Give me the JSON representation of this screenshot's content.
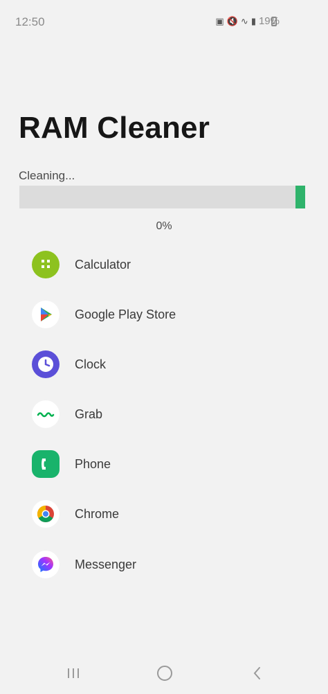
{
  "status_bar": {
    "time": "12:50",
    "battery": "19%"
  },
  "title": "RAM Cleaner",
  "progress": {
    "status_text": "Cleaning...",
    "percent_label": "0%",
    "fill_fraction": 0.03,
    "fill_color": "#2fb36b"
  },
  "apps": [
    {
      "name": "Calculator",
      "icon": "calculator-icon"
    },
    {
      "name": "Google Play Store",
      "icon": "play-store-icon"
    },
    {
      "name": "Clock",
      "icon": "clock-icon"
    },
    {
      "name": "Grab",
      "icon": "grab-icon"
    },
    {
      "name": "Phone",
      "icon": "phone-icon"
    },
    {
      "name": "Chrome",
      "icon": "chrome-icon"
    },
    {
      "name": "Messenger",
      "icon": "messenger-icon"
    }
  ],
  "nav": {
    "recents": "recents-icon",
    "home": "home-icon",
    "back": "back-icon"
  }
}
